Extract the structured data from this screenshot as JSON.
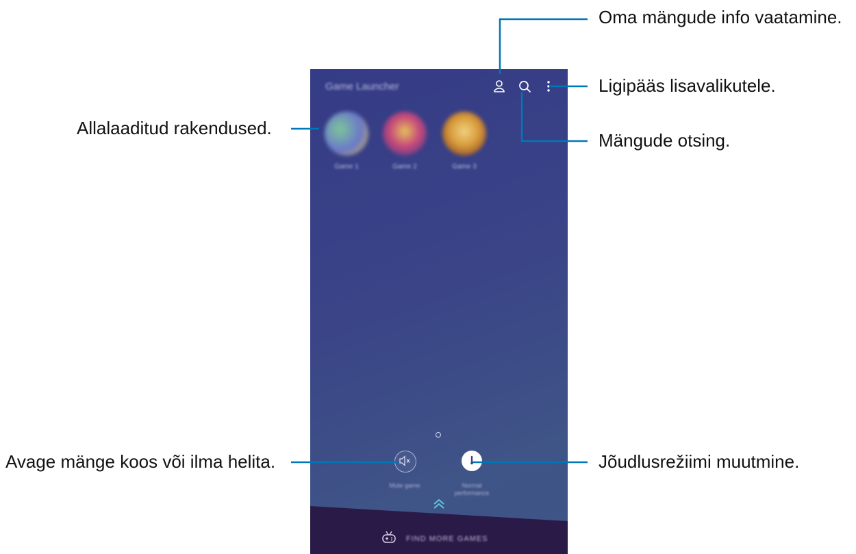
{
  "app": {
    "title": "Game Launcher",
    "games": [
      {
        "name": "Game 1",
        "colors": [
          "#7cc59a",
          "#6b78c9",
          "#c7b25a"
        ]
      },
      {
        "name": "Game 2",
        "colors": [
          "#5a3a8a",
          "#c94b7a",
          "#e2c25a"
        ]
      },
      {
        "name": "Game 3",
        "colors": [
          "#8a4a2a",
          "#d89a3a",
          "#f0d080"
        ]
      }
    ],
    "mute_label": "Mute game",
    "performance_label": "Normal performance",
    "find_more_label": "FIND MORE GAMES"
  },
  "callouts": {
    "profile": "Oma mängude info vaatamine.",
    "more": "Ligipääs lisavalikutele.",
    "search": "Mängude otsing.",
    "games": "Allalaaditud rakendused.",
    "mute": "Avage mänge koos või ilma helita.",
    "performance": "Jõudlusrežiimi muutmine."
  },
  "colors": {
    "leader": "#0077b6",
    "phone_bg": "#3a4487",
    "bottom_band": "#2a1a47",
    "accent_arrows": "#5ec4e0"
  }
}
